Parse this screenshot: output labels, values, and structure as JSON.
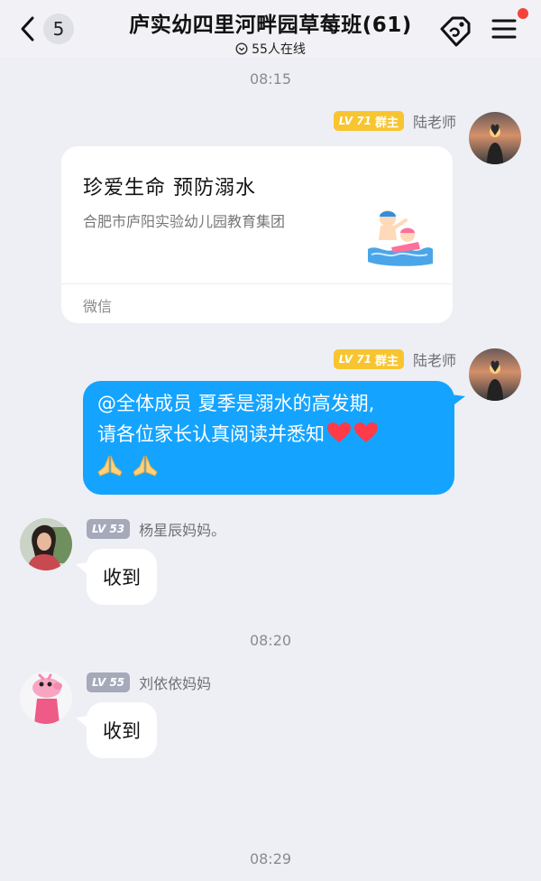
{
  "header": {
    "unread_count": "5",
    "title": "庐实幼四里河畔园草莓班(61)",
    "online_text": "55人在线"
  },
  "timestamps": [
    "08:15",
    "08:20",
    "08:29"
  ],
  "messages": [
    {
      "sender": "陆老师",
      "level": "LV 71",
      "role": "群主",
      "card": {
        "title": "珍爱生命  预防溺水",
        "description": "合肥市庐阳实验幼儿园教育集团",
        "source": "微信"
      }
    },
    {
      "sender": "陆老师",
      "level": "LV 71",
      "role": "群主",
      "line1": "@全体成员 夏季是溺水的高发期,",
      "line2": "请各位家长认真阅读并悉知"
    },
    {
      "sender": "杨星辰妈妈。",
      "level": "LV 53",
      "text": "收到"
    },
    {
      "sender": "刘依依妈妈",
      "level": "LV 55",
      "text": "收到"
    }
  ],
  "colors": {
    "background": "#eeeff4",
    "bubble_blue": "#14a4ff",
    "owner_badge": "#f8c530",
    "member_badge": "#a5a9ba",
    "notification_dot": "#f4433a"
  }
}
